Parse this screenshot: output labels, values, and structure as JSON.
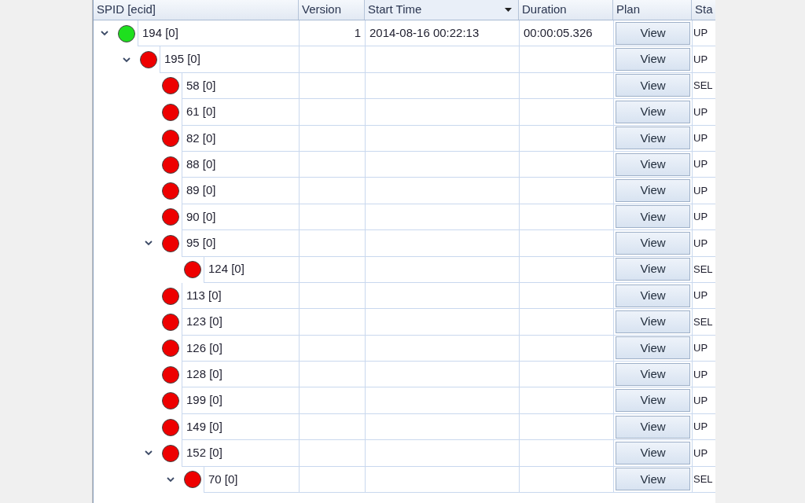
{
  "columns": [
    {
      "label": "SPID [ecid]",
      "sorted": false
    },
    {
      "label": "Version",
      "sorted": false
    },
    {
      "label": "Start Time",
      "sorted": true
    },
    {
      "label": "Duration",
      "sorted": false
    },
    {
      "label": "Plan",
      "sorted": false
    },
    {
      "label": "Sta",
      "sorted": false
    }
  ],
  "rows": [
    {
      "spid": "194 [0]",
      "color": "#1ee01e",
      "expanded": true,
      "version": "1",
      "start_time": "2014-08-16 00:22:13",
      "duration": "00:00:05.326",
      "plan": "View",
      "status": "UP",
      "children": [
        {
          "spid": "195 [0]",
          "color": "#ee0000",
          "expanded": true,
          "plan": "View",
          "status": "UP",
          "children": [
            {
              "spid": "58 [0]",
              "color": "#ee0000",
              "plan": "View",
              "status": "SEL"
            },
            {
              "spid": "61 [0]",
              "color": "#ee0000",
              "plan": "View",
              "status": "UP"
            },
            {
              "spid": "82 [0]",
              "color": "#ee0000",
              "plan": "View",
              "status": "UP"
            },
            {
              "spid": "88 [0]",
              "color": "#ee0000",
              "plan": "View",
              "status": "UP"
            },
            {
              "spid": "89 [0]",
              "color": "#ee0000",
              "plan": "View",
              "status": "UP"
            },
            {
              "spid": "90 [0]",
              "color": "#ee0000",
              "plan": "View",
              "status": "UP"
            },
            {
              "spid": "95 [0]",
              "color": "#ee0000",
              "expanded": true,
              "plan": "View",
              "status": "UP",
              "children": [
                {
                  "spid": "124 [0]",
                  "color": "#ee0000",
                  "plan": "View",
                  "status": "SEL"
                }
              ]
            },
            {
              "spid": "113 [0]",
              "color": "#ee0000",
              "plan": "View",
              "status": "UP"
            },
            {
              "spid": "123 [0]",
              "color": "#ee0000",
              "plan": "View",
              "status": "SEL"
            },
            {
              "spid": "126 [0]",
              "color": "#ee0000",
              "plan": "View",
              "status": "UP"
            },
            {
              "spid": "128 [0]",
              "color": "#ee0000",
              "plan": "View",
              "status": "UP"
            },
            {
              "spid": "199 [0]",
              "color": "#ee0000",
              "plan": "View",
              "status": "UP"
            },
            {
              "spid": "149 [0]",
              "color": "#ee0000",
              "plan": "View",
              "status": "UP"
            },
            {
              "spid": "152 [0]",
              "color": "#ee0000",
              "expanded": true,
              "plan": "View",
              "status": "UP",
              "children": [
                {
                  "spid": "70 [0]",
                  "color": "#ee0000",
                  "expanded": true,
                  "plan": "View",
                  "status": "SEL"
                }
              ]
            }
          ]
        }
      ]
    }
  ]
}
